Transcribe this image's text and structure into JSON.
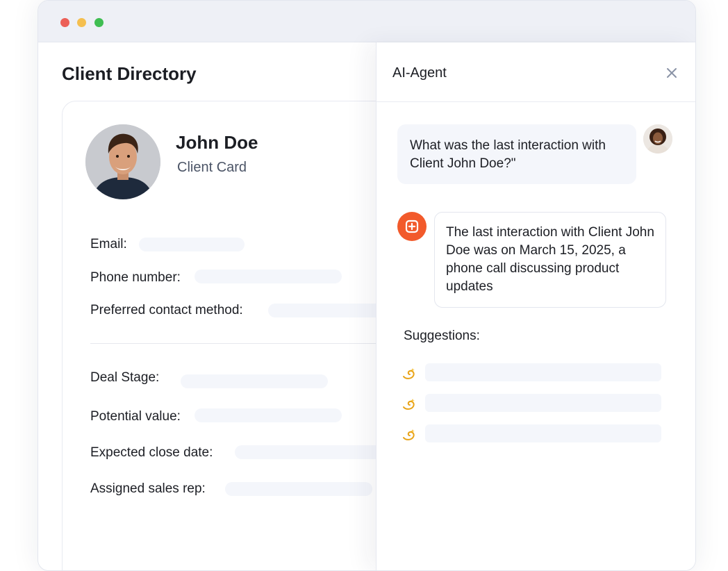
{
  "window": {
    "traffic_lights": [
      "close",
      "minimize",
      "zoom"
    ],
    "colors": {
      "red": "#ec5f57",
      "yellow": "#f5bf4f",
      "green": "#3fbe52"
    }
  },
  "directory": {
    "title": "Client Directory",
    "client": {
      "name": "John Doe",
      "subtitle": "Client Card"
    },
    "contact_fields": [
      {
        "label": "Email:"
      },
      {
        "label": "Phone number:"
      },
      {
        "label": "Preferred contact method:"
      }
    ],
    "deal_fields": [
      {
        "label": "Deal Stage:"
      },
      {
        "label": "Potential value:"
      },
      {
        "label": "Expected close date:"
      },
      {
        "label": "Assigned sales rep:"
      }
    ]
  },
  "agent_panel": {
    "title": "AI-Agent",
    "close_icon": "close-icon",
    "user_message": "What was the last interaction with Client John Doe?\"",
    "bot_message": "The last interaction with Client John Doe was on March 15, 2025, a phone call discussing product updates",
    "suggestions_label": "Suggestions:",
    "suggestion_icon": "dizzy-icon",
    "accent_color": "#f25a2b"
  }
}
